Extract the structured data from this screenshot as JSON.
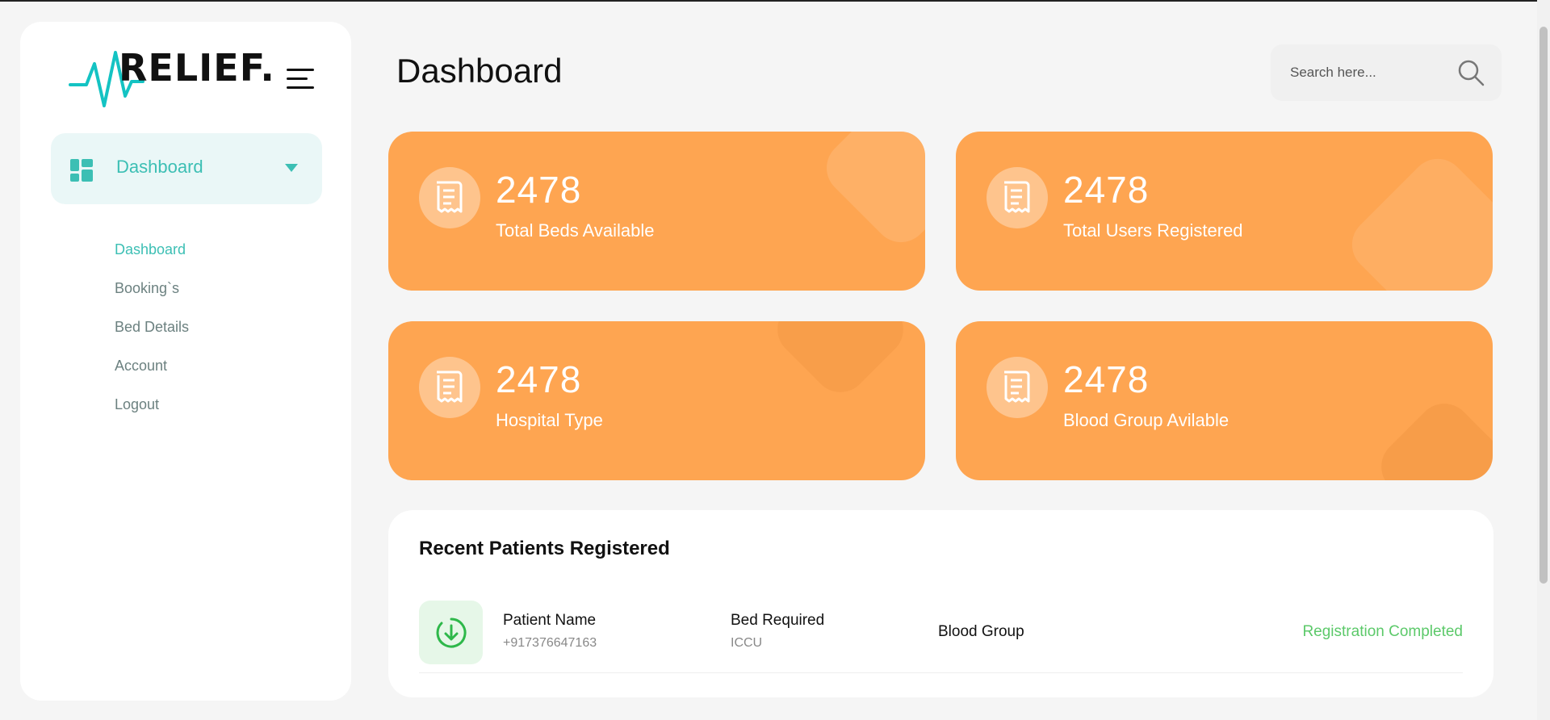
{
  "app": {
    "brand": "RELIEF.",
    "brand_color": "#14c3c3"
  },
  "sidebar": {
    "menu_icon": "hamburger-icon",
    "active_item": {
      "label": "Dashboard",
      "icon": "dashboard-grid-icon"
    },
    "submenu": [
      {
        "label": "Dashboard",
        "active": true
      },
      {
        "label": "Booking`s",
        "active": false
      },
      {
        "label": "Bed Details",
        "active": false
      },
      {
        "label": "Account",
        "active": false
      },
      {
        "label": "Logout",
        "active": false
      }
    ]
  },
  "header": {
    "title": "Dashboard",
    "search_placeholder": "Search here...",
    "search_icon": "search-icon"
  },
  "stats": [
    {
      "value": "2478",
      "label": "Total Beds Available",
      "icon": "receipt-icon"
    },
    {
      "value": "2478",
      "label": "Total Users Registered",
      "icon": "receipt-icon"
    },
    {
      "value": "2478",
      "label": "Hospital Type",
      "icon": "receipt-icon"
    },
    {
      "value": "2478",
      "label": "Blood Group Avilable",
      "icon": "receipt-icon"
    }
  ],
  "recent_patients": {
    "title": "Recent Patients Registered",
    "rows": [
      {
        "icon": "download-circle-icon",
        "name_header": "Patient Name",
        "phone": "+917376647163",
        "bed_header": "Bed Required",
        "bed": "ICCU",
        "blood_header": "Blood Group",
        "status": "Registration Completed"
      }
    ]
  },
  "colors": {
    "accent": "#3cbfb4",
    "card": "#fea551",
    "status_ok": "#5cc96a",
    "background": "#f5f5f5"
  }
}
